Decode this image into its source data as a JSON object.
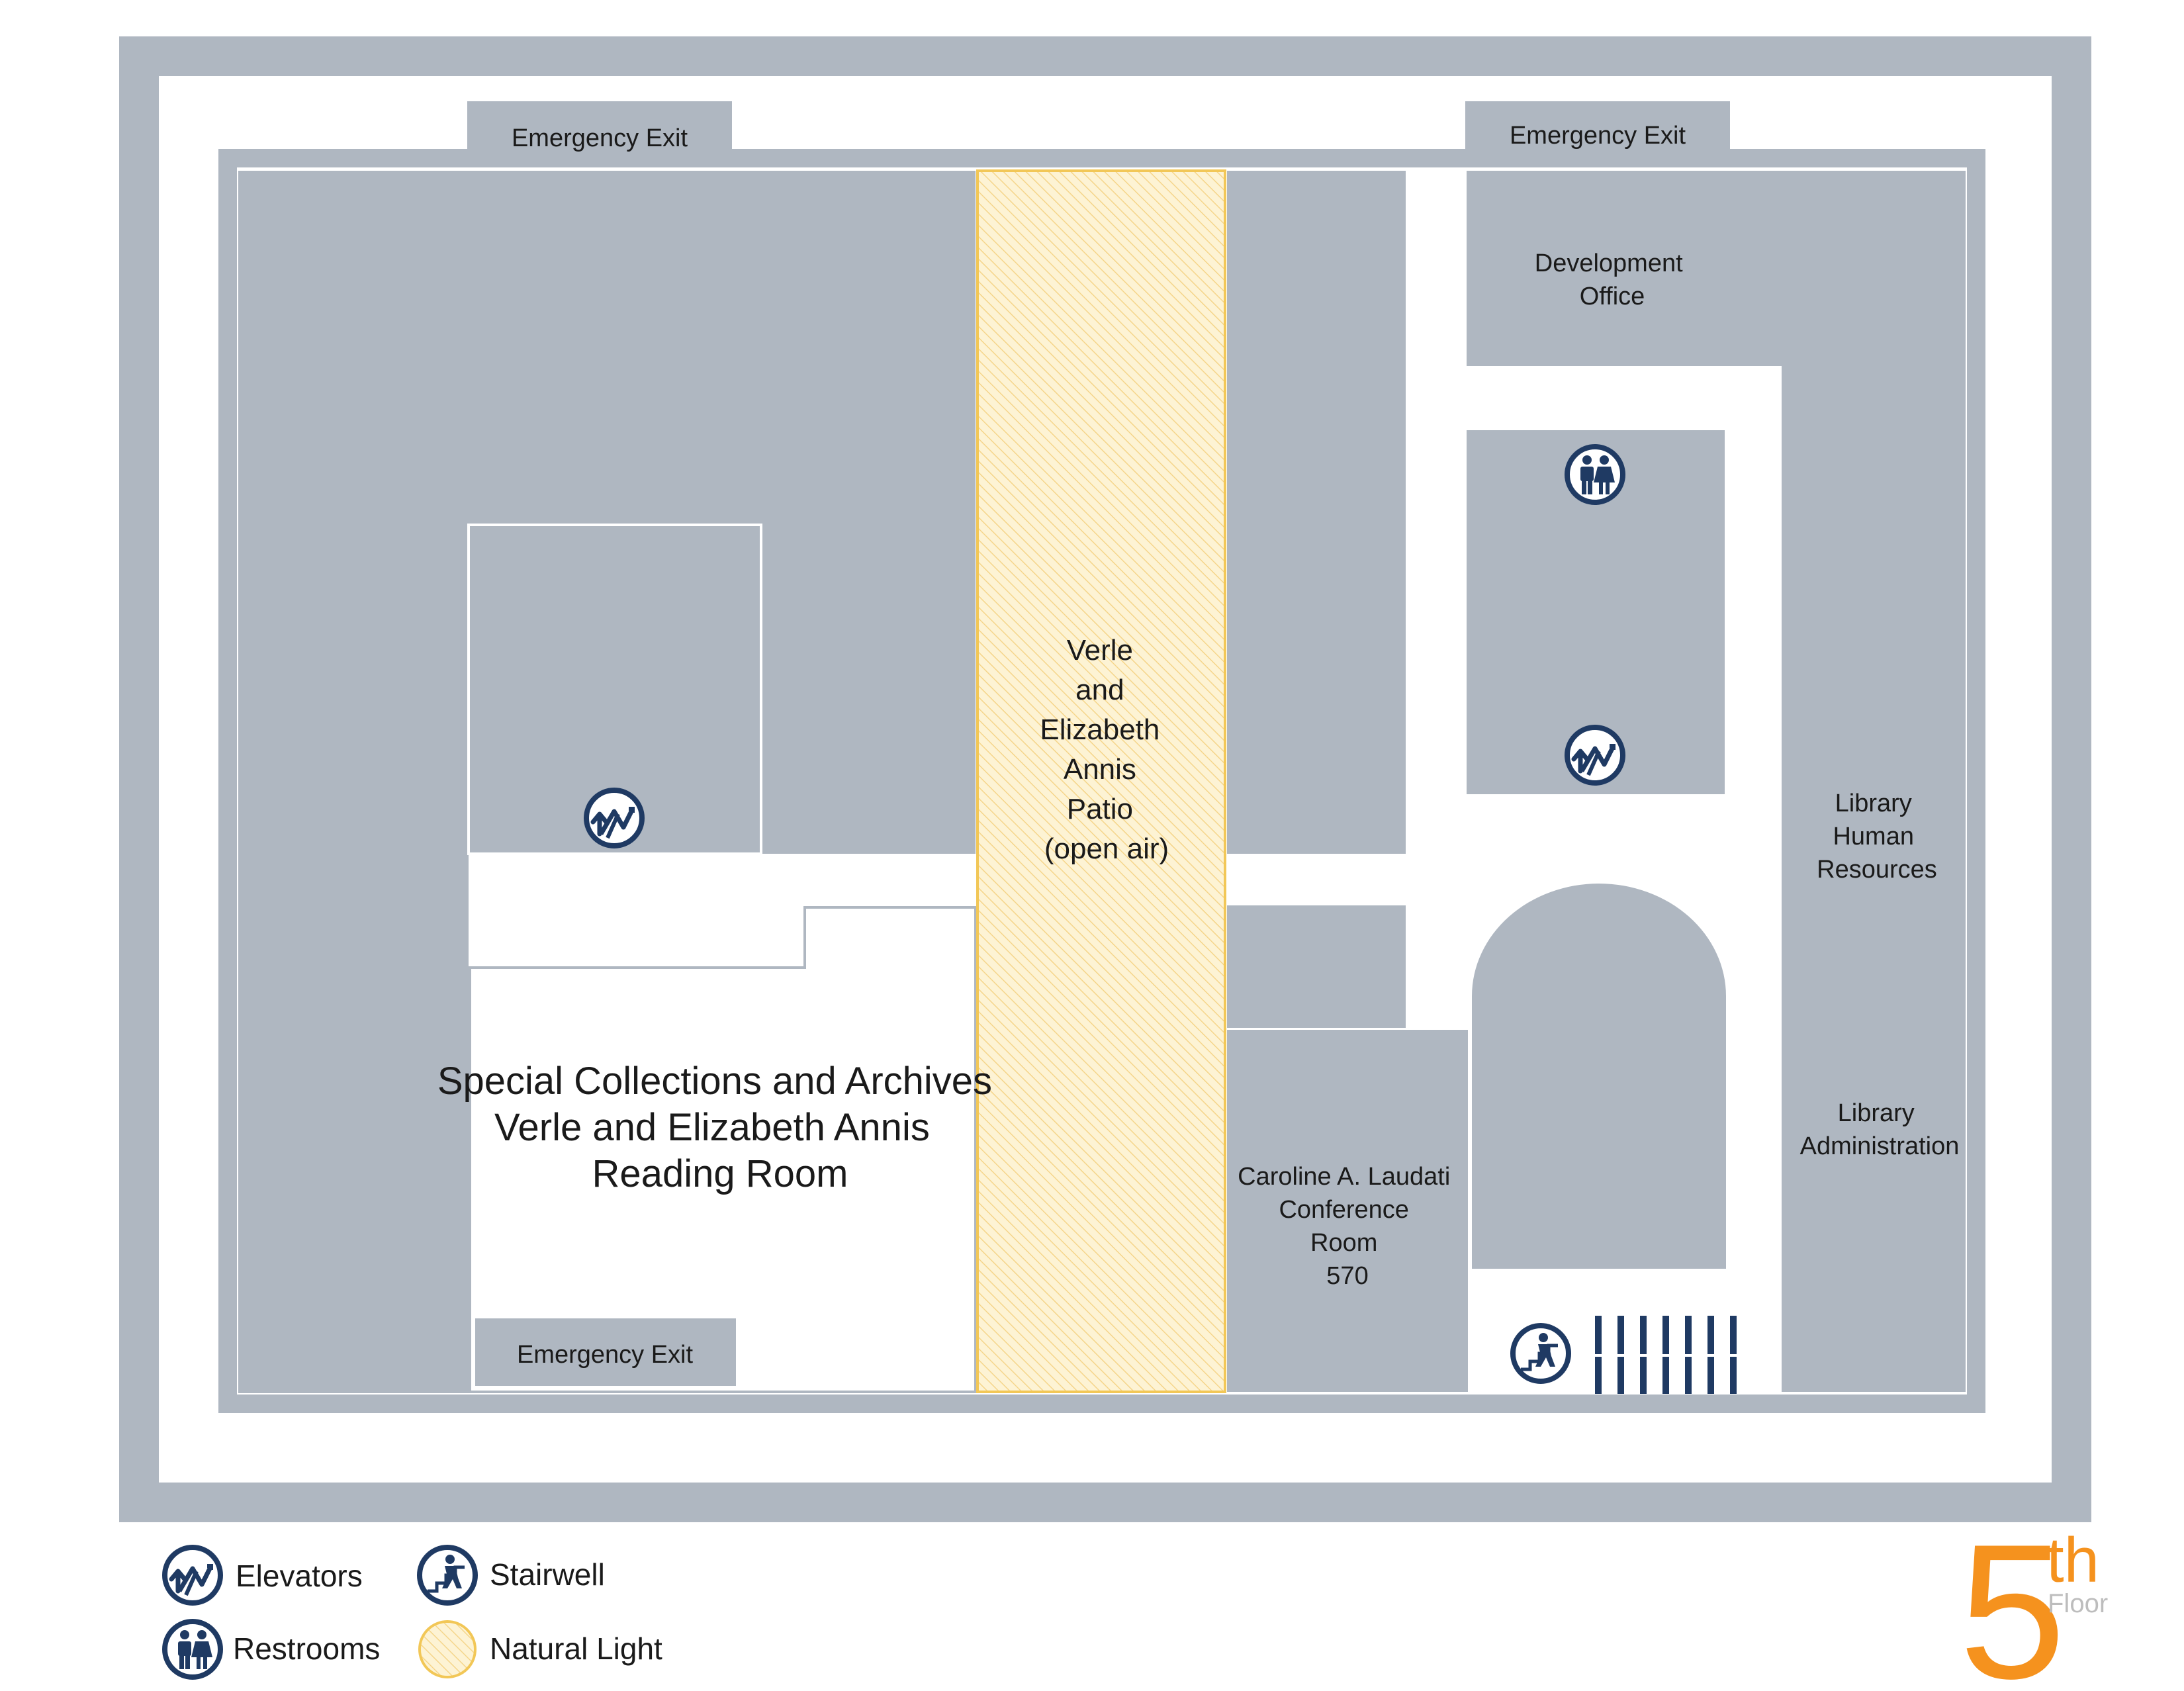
{
  "floor": {
    "number": "5",
    "suffix": "th",
    "word": "Floor"
  },
  "rooms": {
    "emergency_exit_top_left": "Emergency Exit",
    "emergency_exit_top_right": "Emergency Exit",
    "emergency_exit_bottom": "Emergency Exit",
    "development_office": [
      "Development",
      "Office"
    ],
    "patio": [
      "Verle",
      "and",
      "Elizabeth",
      "Annis",
      "Patio",
      "(open air)"
    ],
    "special_collections": [
      "Special Collections and Archives",
      "Verle and Elizabeth Annis",
      "Reading Room"
    ],
    "conference_room": [
      "Caroline A. Laudati",
      "Conference",
      "Room",
      "570"
    ],
    "library_hr": [
      "Library",
      "Human",
      "Resources"
    ],
    "library_admin": [
      "Library",
      "Administration"
    ]
  },
  "legend": {
    "elevators": "Elevators",
    "stairwell": "Stairwell",
    "restrooms": "Restrooms",
    "natural_light": "Natural Light"
  },
  "colors": {
    "wall": "#afb7c1",
    "room": "#afb7c1",
    "icon": "#1f3a63",
    "patio_fill": "#fdf3d4",
    "patio_border": "#f2c757",
    "accent": "#f5921e",
    "floor_word": "#bdbdbd"
  },
  "icons": {
    "elevator": "elevator-icon",
    "restroom": "restroom-icon",
    "stairwell": "stairwell-icon",
    "natural_light": "natural-light-icon"
  }
}
